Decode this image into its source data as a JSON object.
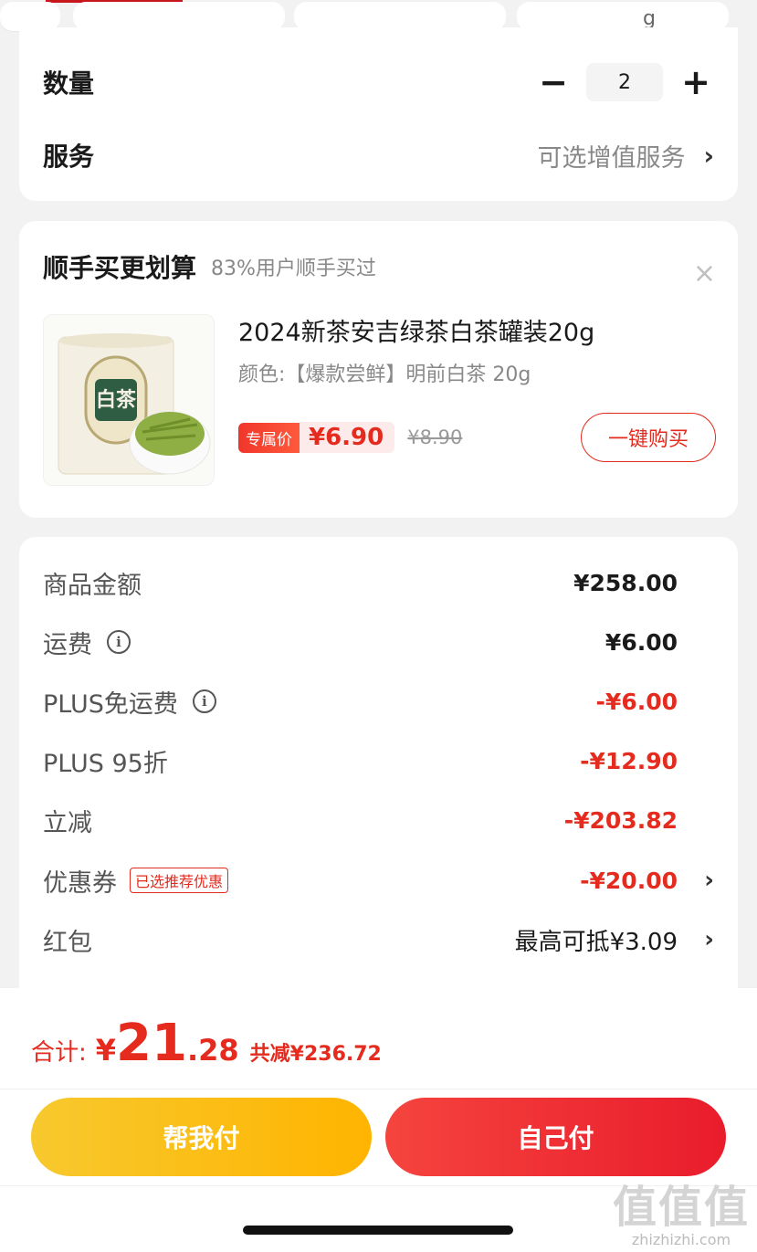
{
  "top": {
    "chip_partial_text": "g"
  },
  "options": {
    "quantity_label": "数量",
    "quantity_minus": "−",
    "quantity_value": "2",
    "quantity_plus": "+",
    "service_label": "服务",
    "service_value": "可选增值服务",
    "service_chevron": "›"
  },
  "addon": {
    "title": "顺手买更划算",
    "subtitle": "83%用户顺手买过",
    "close": "×",
    "product": {
      "title": "2024新茶安吉绿茶白茶罐装20g",
      "spec": "颜色:【爆款尝鲜】明前白茶 20g",
      "exclusive_tag": "专属价",
      "price": "¥6.90",
      "original_price": "¥8.90",
      "buy_button": "一键购买",
      "image_label": "白茶",
      "image_icon": "tea-can-image"
    }
  },
  "summary": {
    "rows": [
      {
        "label": "商品金额",
        "value": "¥258.00"
      },
      {
        "label": "运费",
        "value": "¥6.00"
      },
      {
        "label": "PLUS免运费",
        "value": "-¥6.00"
      },
      {
        "label": "PLUS 95折",
        "value": "-¥12.90"
      },
      {
        "label": "立减",
        "value": "-¥203.82"
      },
      {
        "label": "优惠券",
        "badge": "已选推荐优惠",
        "value": "-¥20.00"
      },
      {
        "label": "红包",
        "value": "最高可抵¥3.09"
      }
    ],
    "info_glyph": "i",
    "chevron": "›"
  },
  "bottom": {
    "total_label": "合计:",
    "total_currency": "¥",
    "total_int": "21",
    "total_dec": ".28",
    "total_saved": "共减¥236.72",
    "help_pay": "帮我付",
    "self_pay": "自己付"
  },
  "watermark": {
    "glyph": "值值值",
    "text": "zhizhizhi.com"
  },
  "colors": {
    "accent_red": "#e52a1e",
    "help_pay_yellow": "#f7c92e",
    "self_pay_red": "#e91c2c"
  }
}
